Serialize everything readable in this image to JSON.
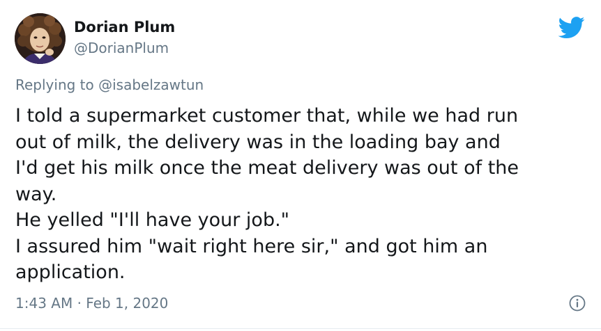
{
  "author": {
    "display_name": "Dorian Plum",
    "handle": "@DorianPlum",
    "avatar_icon": "avatar"
  },
  "brand": {
    "icon": "twitter-bird-icon",
    "color": "#1da1f2"
  },
  "reply": {
    "prefix": "Replying to",
    "mention": "@isabelzawtun"
  },
  "tweet": {
    "lines": [
      "I told a supermarket customer that, while we had run",
      "out of milk, the delivery was in the loading bay and",
      "I'd get his milk once the meat delivery was out of the",
      "way.",
      "He yelled \"I'll have your job.\"",
      "I assured him \"wait right here sir,\" and got him an",
      "application."
    ]
  },
  "footer": {
    "timestamp": "1:43 AM · Feb 1, 2020",
    "info_icon": "info-icon"
  },
  "colors": {
    "text_primary": "#14171a",
    "text_secondary": "#657786",
    "divider": "#e6ecf0"
  }
}
